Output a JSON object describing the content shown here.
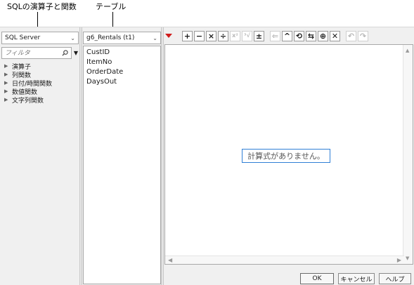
{
  "callouts": {
    "sql_label": "SQLの演算子と関数",
    "table_label": "テーブル"
  },
  "left_panel": {
    "dialect_selected": "SQL Server",
    "filter_placeholder": "フィルタ",
    "tree_items": [
      {
        "label": "演算子"
      },
      {
        "label": "列関数"
      },
      {
        "label": "日付/時間関数"
      },
      {
        "label": "数値関数"
      },
      {
        "label": "文字列関数"
      }
    ]
  },
  "mid_panel": {
    "table_selected": "g6_Rentals (t1)",
    "columns": [
      {
        "label": "CustID"
      },
      {
        "label": "ItemNo"
      },
      {
        "label": "OrderDate"
      },
      {
        "label": "DaysOut"
      }
    ]
  },
  "toolbar": {
    "buttons": [
      {
        "name": "plus",
        "glyph": "+",
        "enabled": true
      },
      {
        "name": "minus",
        "glyph": "−",
        "enabled": true
      },
      {
        "name": "multiply",
        "glyph": "×",
        "enabled": true
      },
      {
        "name": "divide",
        "glyph": "÷",
        "enabled": true
      },
      {
        "name": "raise-power",
        "glyph": "x²",
        "enabled": false
      },
      {
        "name": "root",
        "glyph": "³√",
        "enabled": false
      },
      {
        "name": "plus-minus",
        "glyph": "±",
        "enabled": true
      },
      {
        "name": "assign",
        "glyph": "⇐",
        "enabled": false
      },
      {
        "name": "insert-clause",
        "glyph": "^",
        "enabled": true
      },
      {
        "name": "peel",
        "glyph": "⟲",
        "enabled": true
      },
      {
        "name": "swap",
        "glyph": "⇆",
        "enabled": true
      },
      {
        "name": "local",
        "glyph": "⊕",
        "enabled": true
      },
      {
        "name": "delete",
        "glyph": "✕",
        "enabled": true
      },
      {
        "name": "undo",
        "glyph": "↶",
        "enabled": false
      },
      {
        "name": "redo",
        "glyph": "↷",
        "enabled": false
      }
    ]
  },
  "formula": {
    "empty_message": "計算式がありません。"
  },
  "dialog_buttons": {
    "ok": "OK",
    "cancel": "キャンセル",
    "help": "ヘルプ"
  },
  "colors": {
    "accent_blue": "#2f7fd6",
    "red_triangle": "#d01c1c"
  }
}
